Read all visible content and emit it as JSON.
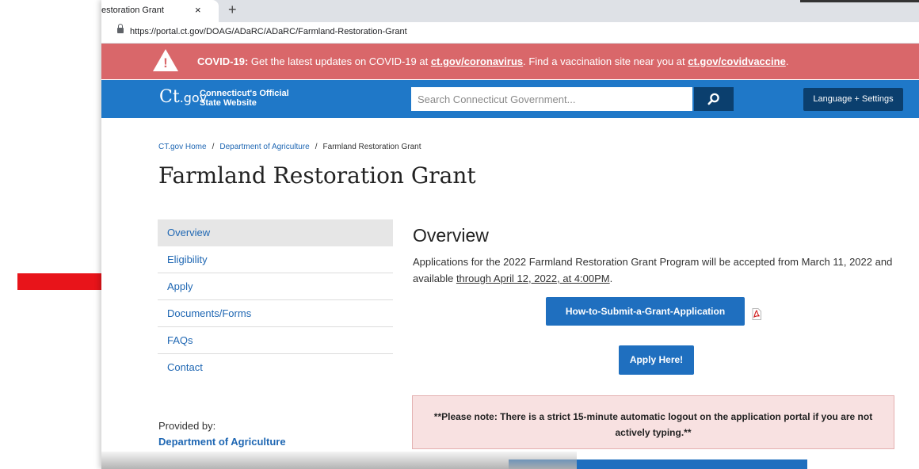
{
  "browser": {
    "tab_title": "estoration Grant",
    "tab_close": "×",
    "new_tab": "+",
    "url": "https://portal.ct.gov/DOAG/ADaRC/ADaRC/Farmland-Restoration-Grant"
  },
  "alert": {
    "label": "COVID-19:",
    "text1": " Get the latest updates on COVID-19 at ",
    "link1": "ct.gov/coronavirus",
    "text2": ".  Find a vaccination site near you at ",
    "link2": "ct.gov/covidvaccine",
    "text3": "."
  },
  "header": {
    "logo_ct": "Ct",
    "logo_gov": ".gov",
    "tagline_line1": "Connecticut's Official",
    "tagline_line2": "State Website",
    "search_placeholder": "Search Connecticut Government...",
    "language_button": "Language + Settings"
  },
  "breadcrumb": {
    "home": "CT.gov Home",
    "sep": "/",
    "dept": "Department of Agriculture",
    "current": "Farmland Restoration Grant"
  },
  "page_title": "Farmland Restoration Grant",
  "sidebar": {
    "items": [
      {
        "label": "Overview"
      },
      {
        "label": "Eligibility"
      },
      {
        "label": "Apply"
      },
      {
        "label": "Documents/Forms"
      },
      {
        "label": "FAQs"
      },
      {
        "label": "Contact"
      }
    ],
    "provided_label": "Provided by:",
    "provided_link": "Department of Agriculture"
  },
  "main": {
    "heading": "Overview",
    "paragraph_part1": "Applications for the 2022 Farmland Restoration Grant Program will be accepted from March 11, 2022 and available ",
    "paragraph_underlined": "through April 12, 2022, at 4:00PM",
    "paragraph_end": ".",
    "how_to_button": "How-to-Submit-a-Grant-Application",
    "apply_button": "Apply Here!",
    "note": "**Please note: There is a strict 15-minute automatic logout on the application portal if you are not actively typing.**"
  },
  "colors": {
    "alert_bg": "#d9676a",
    "header_bg": "#1f78c8",
    "button_blue": "#1f6fbf",
    "dark_blue": "#0b3f6e",
    "arrow": "#e8141a",
    "note_bg": "#f8e1e1"
  }
}
